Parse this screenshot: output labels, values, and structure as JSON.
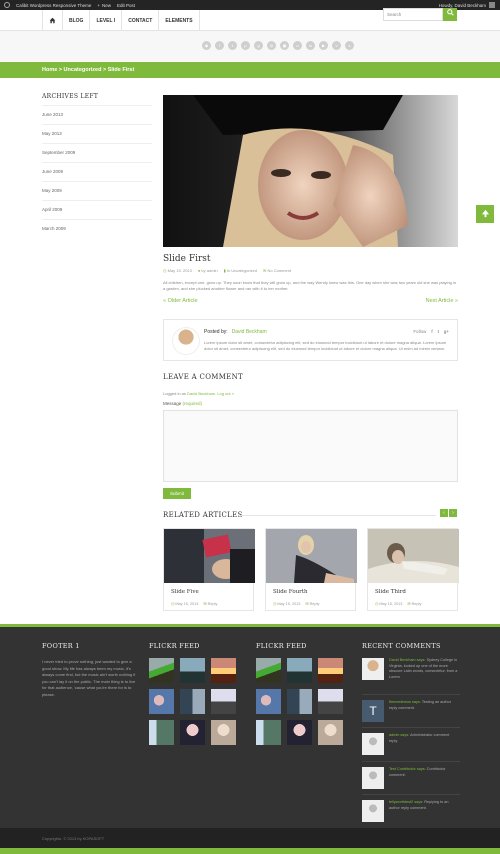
{
  "admin_bar": {
    "site_name": "Calibit Wordpress Responsive Theme",
    "new_label": "New",
    "edit_label": "Edit Post",
    "howdy": "Howdy, David Beckham"
  },
  "nav": {
    "items": [
      "BLOG",
      "LEVEL I",
      "CONTACT",
      "ELEMENTS"
    ]
  },
  "social": {
    "icons": [
      "rss-icon",
      "facebook-icon",
      "twitter-icon",
      "pinterest-icon",
      "google-plus-icon",
      "dribbble-icon",
      "instagram-icon",
      "flickr-icon",
      "linkedin-icon",
      "youtube-icon",
      "vimeo-icon",
      "skype-icon"
    ]
  },
  "search": {
    "placeholder": "Search"
  },
  "breadcrumb": "Home > Uncategorized > Slide First",
  "sidebar": {
    "title": "ARCHIVES LEFT",
    "items": [
      "June 2013",
      "May 2013",
      "September 2009",
      "June 2009",
      "May 2009",
      "April 2009",
      "March 2009"
    ]
  },
  "post": {
    "title": "Slide First",
    "date": "May 15, 2013",
    "author": "by admin",
    "category": "in Uncategorized",
    "comments": "No Comment",
    "body": "All children, except one, grow up. They soon know that they will grow up, and the way Wendy knew was this. One day when she was two years old she was playing in a garden, and she plucked another flower and ran with it to her mother.",
    "older": "« Older Article",
    "newer": "Next Article »"
  },
  "author_box": {
    "posted_by": "Posted by:",
    "name": "David Beckham",
    "follow": "Follow",
    "bio": "Lorem ipsum dolor sit amet, consectetur adipiscing elit, sed do eiusmod tempor incididunt ut labore et dolore magna aliqua. Lorem ipsum dolor sit amet, consectetur adipiscing elit, sed do eiusmod tempor incididunt ut labore et dolore magna aliqua. Ut enim ad minim veniam."
  },
  "comment_form": {
    "title": "LEAVE A COMMENT",
    "logged_in": "Logged in as",
    "logged_user": "David Beckham. Log out »",
    "message_label": "Message",
    "required": "(required)",
    "submit": "Submit"
  },
  "related": {
    "title": "RELATED ARTICLES",
    "items": [
      {
        "title": "Slide Five",
        "date": "May 15, 2013",
        "reply": "Reply"
      },
      {
        "title": "Slide Fourth",
        "date": "May 15, 2013",
        "reply": "Reply"
      },
      {
        "title": "Slide Third",
        "date": "May 15, 2013",
        "reply": "Reply"
      }
    ]
  },
  "footer": {
    "col1_title": "FOOTER 1",
    "col1_text": "I never tried to prove nothing, just wanted to give a good show. My life has always been my music, it's always come first, but the music ain't worth nothing if you can't lay it on the public. The main thing is to live for that audience, 'cause what you're there for is to please.",
    "flickr1_title": "FLICKR FEED",
    "flickr2_title": "FLICKR FEED",
    "recent_title": "RECENT COMMENTS",
    "comments": [
      {
        "author": "David Beckham says:",
        "text": "Sydney College in Virginia, looked up one of the more obscure Latin words, consectetur, from a Lorem"
      },
      {
        "author": "themedemos says:",
        "text": "Testing an author reply comment."
      },
      {
        "author": "admin says:",
        "text": "Administrator comment reply."
      },
      {
        "author": "Test Contributor says:",
        "text": "Contributor comment."
      },
      {
        "author": "tellyworthtest2 says:",
        "text": "Replying to an author reply comment."
      }
    ]
  },
  "copyright": "Copyrights, © 2013 by KOPASOFT"
}
